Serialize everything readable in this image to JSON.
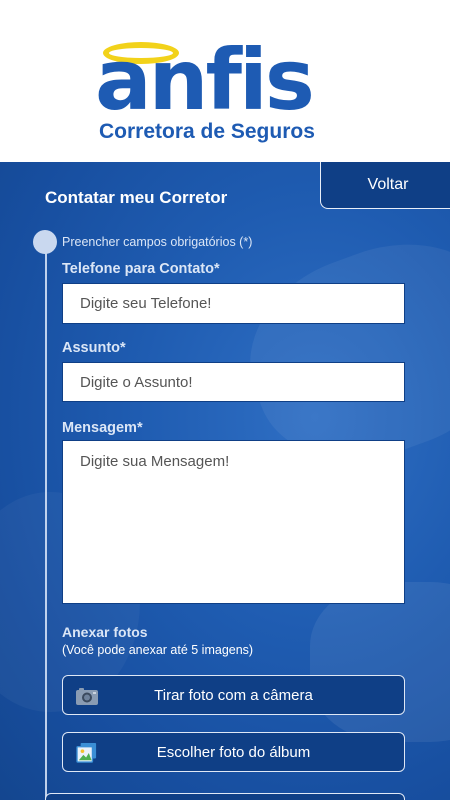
{
  "brand": {
    "logo_word": "anfis",
    "logo_subtitle": "Corretora de Seguros",
    "primary_color": "#1e5bb3",
    "halo_color": "#f2d21a"
  },
  "nav": {
    "back_label": "Voltar"
  },
  "page": {
    "title": "Contatar meu Corretor",
    "required_note": "Preencher campos obrigatórios (*)"
  },
  "form": {
    "phone": {
      "label": "Telefone para Contato*",
      "placeholder": "Digite seu Telefone!",
      "value": ""
    },
    "subject": {
      "label": "Assunto*",
      "placeholder": "Digite o Assunto!",
      "value": ""
    },
    "message": {
      "label": "Mensagem*",
      "placeholder": "Digite sua Mensagem!",
      "value": ""
    }
  },
  "attach": {
    "title": "Anexar fotos",
    "note": "(Você pode anexar até 5 imagens)",
    "camera_button": {
      "label": "Tirar foto com a câmera",
      "icon": "camera-icon"
    },
    "album_button": {
      "label": "Escolher foto do álbum",
      "icon": "photo-album-icon"
    }
  }
}
